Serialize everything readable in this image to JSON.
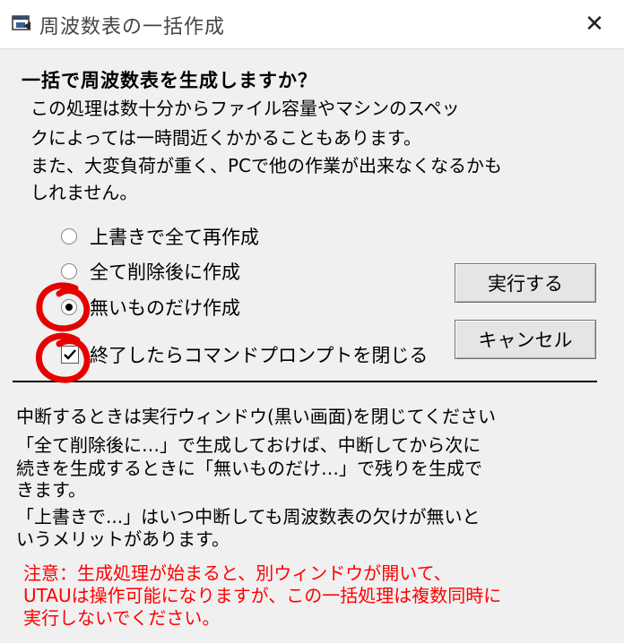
{
  "window": {
    "title": "周波数表の一括作成",
    "close_glyph": "✕"
  },
  "dialog": {
    "heading": "一括で周波数表を生成しますか？",
    "description": [
      "この処理は数十分からファイル容量やマシンのスペッ",
      "クによっては一時間近くかかることもあります。",
      "また、大変負荷が重く、PCで他の作業が出来なくなるかも",
      "しれません。"
    ],
    "options": [
      {
        "label": "上書きで全て再作成",
        "checked": false
      },
      {
        "label": "全て削除後に作成",
        "checked": false
      },
      {
        "label": "無いものだけ作成",
        "checked": true
      }
    ],
    "close_prompt_checkbox": {
      "label": "終了したらコマンドプロンプトを閉じる",
      "checked": true
    },
    "buttons": {
      "execute": "実行する",
      "cancel": "キャンセル"
    },
    "notes": [
      "中断するときは実行ウィンドウ(黒い画面)を閉じてください",
      "「全て削除後に…」で生成しておけば、中断してから次に",
      "続きを生成するときに「無いものだけ…」で残りを生成で",
      "きます。",
      "「上書きで...」はいつ中断しても周波数表の欠けが無いと",
      "いうメリットがあります。"
    ],
    "warning": [
      "注意：生成処理が始まると、別ウィンドウが開いて、",
      "UTAUは操作可能になりますが、この一括処理は複数同時に",
      "実行しないでください。"
    ]
  },
  "colors": {
    "warning": "#ff0000",
    "annotation": "#e60000"
  }
}
